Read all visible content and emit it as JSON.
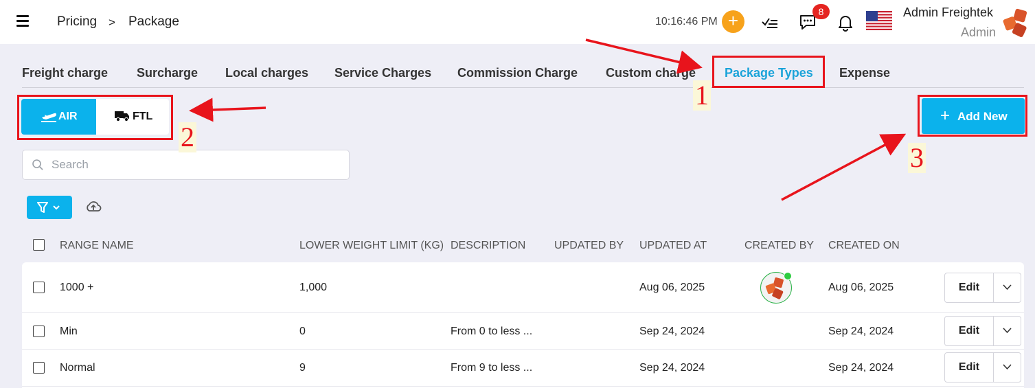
{
  "header": {
    "breadcrumb": [
      "Pricing",
      ">",
      "Package"
    ],
    "time": "10:16:46 PM",
    "add_icon": "plus",
    "notification_badge": "8",
    "user_name": "Admin Freightek",
    "user_role": "Admin",
    "icons": [
      "menu-icon",
      "plus-icon",
      "checklist-icon",
      "chat-icon",
      "bell-icon",
      "us-flag-icon",
      "logo"
    ]
  },
  "tabs": [
    {
      "label": "Freight charge"
    },
    {
      "label": "Surcharge"
    },
    {
      "label": "Local charges"
    },
    {
      "label": "Service Charges"
    },
    {
      "label": "Commission Charge"
    },
    {
      "label": "Custom charge"
    },
    {
      "label": "Package Types",
      "active": true
    },
    {
      "label": "Expense"
    }
  ],
  "mode": {
    "air": "AIR",
    "ftl": "FTL",
    "selected": "AIR"
  },
  "add_new": "Add New",
  "search": {
    "placeholder": "Search",
    "value": ""
  },
  "table": {
    "columns": [
      "RANGE NAME",
      "LOWER WEIGHT LIMIT (KG)",
      "DESCRIPTION",
      "UPDATED BY",
      "UPDATED AT",
      "CREATED BY",
      "CREATED ON"
    ],
    "rows": [
      {
        "range_name": "1000 +",
        "lower_limit": "1,000",
        "description": "",
        "updated_by": "",
        "updated_at": "Aug 06, 2025",
        "created_by": "avatar",
        "created_on": "Aug 06, 2025",
        "action": "Edit"
      },
      {
        "range_name": "Min",
        "lower_limit": "0",
        "description": "From 0 to less ...",
        "updated_by": "",
        "updated_at": "Sep 24, 2024",
        "created_by": "",
        "created_on": "Sep 24, 2024",
        "action": "Edit"
      },
      {
        "range_name": "Normal",
        "lower_limit": "9",
        "description": "From 9 to less ...",
        "updated_by": "",
        "updated_at": "Sep 24, 2024",
        "created_by": "",
        "created_on": "Sep 24, 2024",
        "action": "Edit"
      }
    ]
  },
  "annotations": [
    "1",
    "2",
    "3"
  ],
  "colors": {
    "accent": "#0bb2ec",
    "annotation": "#e8141c",
    "badge": "#e52420",
    "add": "#f7a21b"
  }
}
